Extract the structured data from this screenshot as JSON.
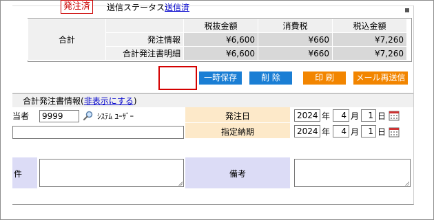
{
  "summary": {
    "total_label": "合計",
    "headers": [
      "税抜金額",
      "消費税",
      "税込金額"
    ],
    "rows": [
      {
        "label": "発注情報",
        "values": [
          "¥6,600",
          "¥660",
          "¥7,260"
        ]
      },
      {
        "label": "合計発注書明細",
        "values": [
          "¥6,600",
          "¥660",
          "¥7,260"
        ]
      }
    ]
  },
  "status": {
    "badge": "発注済",
    "label": "送信ステータス:",
    "link": "送信済"
  },
  "buttons": {
    "save": "一時保存",
    "delete": "削 除",
    "print": "印 刷",
    "resend": "メール再送信"
  },
  "colors": {
    "blue_button": "#1a7ed4",
    "orange_button": "#f28500",
    "badge_red": "#cc0000",
    "highlight_red": "#d40000"
  },
  "section": {
    "title": "合計発注書情報",
    "paren_open": "(",
    "toggle_link": "非表示にする",
    "paren_close": ")"
  },
  "form": {
    "orderer_label_fragment": "当者",
    "orderer_code": "9999",
    "orderer_name": "ｼｽﾃﾑ ﾕｰｻﾞｰ",
    "wide_field_value": "",
    "order_date_label": "発注日",
    "order_date": {
      "year": "2024",
      "month": "4",
      "day": "1"
    },
    "due_date_label": "指定納期",
    "due_date": {
      "year": "2024",
      "month": "4",
      "day": "1"
    },
    "year_unit": "年",
    "month_unit": "月",
    "day_unit": "日",
    "subject_label_fragment": "件",
    "subject_value": "",
    "remarks_label": "備考",
    "remarks_value": ""
  }
}
